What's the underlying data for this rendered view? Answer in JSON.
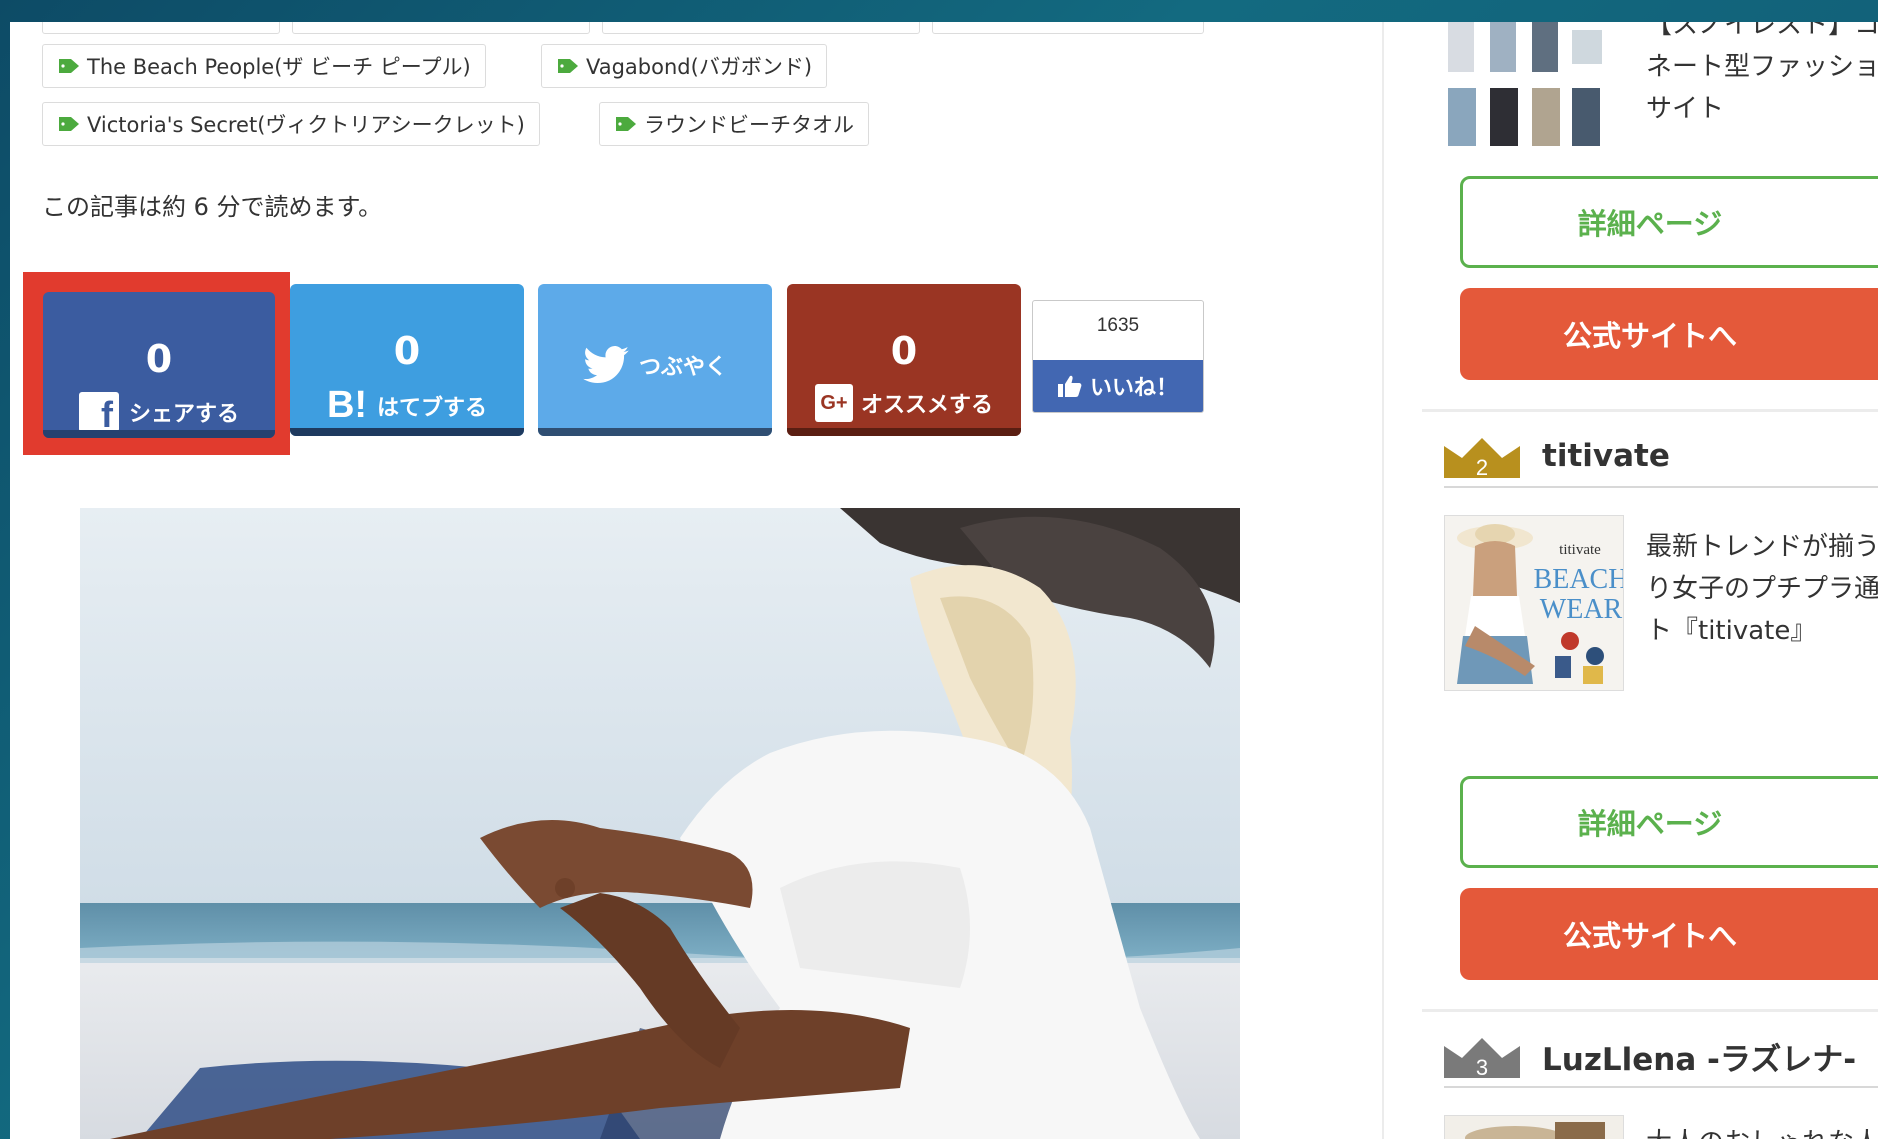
{
  "article": {
    "tags": [
      {
        "label": "The Beach People(ザ ビーチ ピープル)"
      },
      {
        "label": "Vagabond(バガボンド)"
      },
      {
        "label": "Victoria's Secret(ヴィクトリアシークレット)"
      },
      {
        "label": "ラウンドビーチタオル"
      }
    ],
    "read_time": "この記事は約 6 分で読めます。"
  },
  "share": {
    "facebook": {
      "count": "0",
      "label": "シェアする",
      "icon": "facebook-icon"
    },
    "hatena": {
      "count": "0",
      "label": "はてブする",
      "glyph": "B!",
      "icon": "hatena-bookmark-icon"
    },
    "twitter": {
      "label": "つぶやく",
      "icon": "twitter-bird-icon"
    },
    "google": {
      "count": "0",
      "label": "オススメする",
      "glyph": "G+",
      "icon": "google-plus-icon"
    },
    "like": {
      "count": "1635",
      "label": "いいね！",
      "icon": "thumbs-up-icon"
    }
  },
  "sidebar": {
    "item1": {
      "desc_lines": [
        "【スノイレスト】コ",
        "ネート型ファッショ",
        "サイト"
      ],
      "detail_label": "詳細ページ",
      "official_label": "公式サイトへ"
    },
    "item2": {
      "rank": "2",
      "name": "titivate",
      "thumb_brand": "titivate",
      "thumb_text1": "BEACH",
      "thumb_text2": "WEAR",
      "desc_lines": [
        "最新トレンドが揃う",
        "り女子のプチプラ通",
        "ト『titivate』"
      ],
      "detail_label": "詳細ページ",
      "official_label": "公式サイトへ"
    },
    "item3": {
      "rank": "3",
      "name": "LuzLlena -ラズレナ-",
      "desc_lines": [
        "大人のおしゃれな人"
      ]
    }
  },
  "colors": {
    "facebook": "#3b5ca0",
    "hatena": "#3e9ee0",
    "twitter": "#5daae9",
    "google": "#9a3523",
    "highlight": "#e13b2e",
    "detail_green": "#5bb14d",
    "official_orange": "#e4593a",
    "gold_crown": "#b8901e",
    "bronze_crown": "#7a7a7a"
  }
}
